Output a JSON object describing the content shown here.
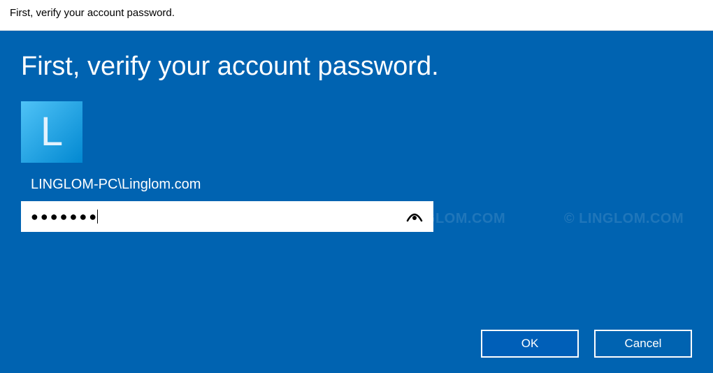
{
  "titlebar": {
    "text": "First, verify your account password."
  },
  "dialog": {
    "heading": "First, verify your account password.",
    "avatar_letter": "L",
    "username": "LINGLOM-PC\\Linglom.com",
    "password_value": "●●●●●●●",
    "watermark": "© LINGLOM.COM",
    "buttons": {
      "ok": "OK",
      "cancel": "Cancel"
    }
  }
}
